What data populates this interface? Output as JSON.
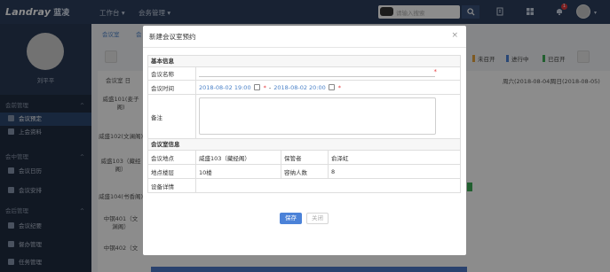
{
  "topbar": {
    "logo": "Landray",
    "logo_sub": "蓝凌",
    "nav": [
      "工作台 ▾",
      "会务管理 ▾"
    ],
    "search_placeholder": "请输入搜索",
    "notification_count": "1"
  },
  "sidebar": {
    "user_name": "刘平平",
    "groups": [
      {
        "label": "会前管理",
        "items": [
          {
            "label": "会议预定",
            "active": true
          },
          {
            "label": "上会资料",
            "active": false
          }
        ]
      },
      {
        "label": "会中管理",
        "items": [
          {
            "label": "会议日历",
            "active": false
          },
          {
            "label": "会议安排",
            "active": false
          }
        ]
      },
      {
        "label": "会后管理",
        "items": [
          {
            "label": "会议纪要",
            "active": false
          },
          {
            "label": "督办管理",
            "active": false
          },
          {
            "label": "任务管理",
            "active": false
          }
        ]
      }
    ]
  },
  "background": {
    "tabs": [
      "会议室",
      "会"
    ],
    "legend": [
      "未召开",
      "进行中",
      "已召开"
    ],
    "header_left": "会议室",
    "header_left_suffix": "日",
    "rooms": [
      "威盛101(麦子\n阁)",
      "威盛102(文澜阁)",
      "威盛103（藏经\n阁）",
      "威盛104(书香阁)",
      "中钢401（文\n渊阁）",
      "中钢402（文"
    ],
    "dates": [
      "周六(2018-08-04)",
      "周日(2018-08-05)"
    ]
  },
  "modal": {
    "title": "新建会议室预约",
    "close_glyph": "×",
    "section_basic": "基本信息",
    "meeting_name_label": "会议名称",
    "meeting_name_value": "",
    "meeting_time_label": "会议时间",
    "start_time": "2018-08-02 19:00",
    "time_sep": "-",
    "end_time": "2018-08-02 20:00",
    "remarks_label": "备注",
    "remarks_value": "",
    "section_room": "会议室信息",
    "location_label": "会议地点",
    "location_value": "威盛103（藏经阁）",
    "keeper_label": "保管者",
    "keeper_value": "俞泽虹",
    "floor_label": "地点楼层",
    "floor_value": "10楼",
    "capacity_label": "容纳人数",
    "capacity_value": "8",
    "equipment_label": "设备详情",
    "equipment_value": "",
    "save_label": "保存",
    "close_label": "关闭"
  },
  "colors": {
    "topbar": "#2c3e5e",
    "sidebar": "#1f2c40",
    "accent": "#4b82d8",
    "required": "#e4393c",
    "status_not_started": "#e6a23c",
    "status_in_progress": "#4b82d8",
    "status_done": "#3dae56"
  }
}
